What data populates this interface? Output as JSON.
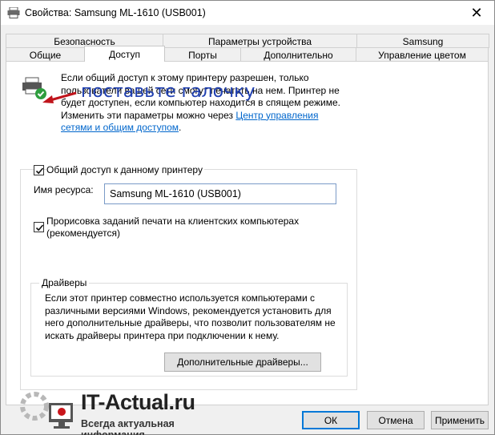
{
  "window": {
    "title": "Свойства: Samsung ML-1610 (USB001)",
    "close_glyph": "✕"
  },
  "tabs": {
    "back_row": [
      "Безопасность",
      "Параметры устройства",
      "Samsung"
    ],
    "front_row": [
      "Общие",
      "Доступ",
      "Порты",
      "Дополнительно",
      "Управление цветом"
    ],
    "active": "Доступ"
  },
  "info": {
    "text": "Если общий доступ к этому принтеру разрешен, только пользователи вашей сети смогут печатать на нем. Принтер не будет доступен, если компьютер находится в спящем режиме. Изменить эти параметры можно через ",
    "link": "Центр управления сетями и общим доступом",
    "suffix": "."
  },
  "annotation": {
    "text": "поставьте галочку",
    "color": "#1f3fb0"
  },
  "sharing": {
    "share_checkbox_label": "Общий доступ к данному принтеру",
    "share_checked": true,
    "resource_label": "Имя ресурса:",
    "resource_value": "Samsung ML-1610 (USB001)",
    "render_checkbox_label": "Прорисовка заданий печати на клиентских компьютерах (рекомендуется)",
    "render_checked": true
  },
  "drivers": {
    "title": "Драйверы",
    "text": "Если этот принтер совместно используется компьютерами с различными версиями Windows, рекомендуется установить для него дополнительные драйверы, что позволит пользователям не искать драйверы принтера при подключении к нему.",
    "button": "Дополнительные драйверы..."
  },
  "buttons": {
    "ok": "ОК",
    "cancel": "Отмена",
    "apply": "Применить"
  },
  "watermark": {
    "title": "IT-Actual.ru",
    "subtitle": "Всегда актуальная информация"
  },
  "colors": {
    "link": "#0066cc",
    "accent": "#0078d7",
    "check_green": "#2e9e3e"
  }
}
